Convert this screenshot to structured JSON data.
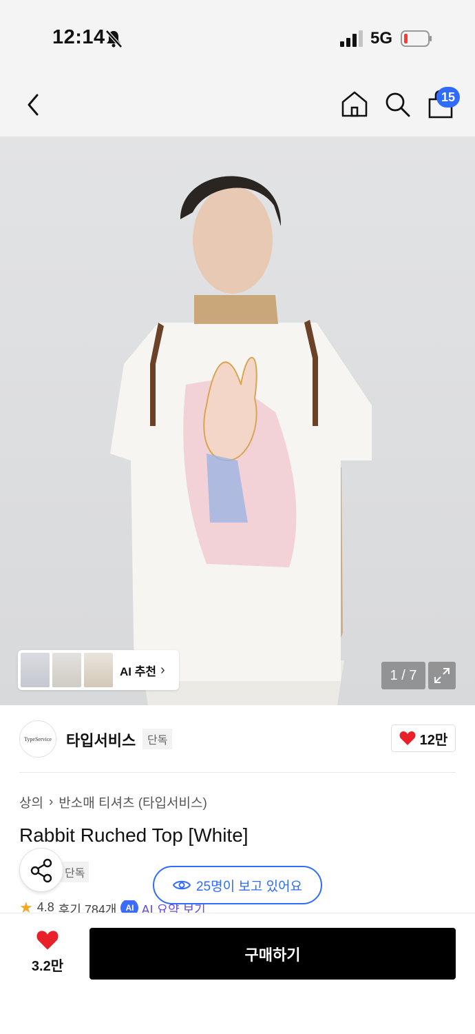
{
  "status": {
    "time": "12:14",
    "network": "5G"
  },
  "nav": {
    "cart_count": "15"
  },
  "gallery": {
    "counter": "1 / 7",
    "ai_label": "AI 추천"
  },
  "brand": {
    "logo_text": "TypeService",
    "name": "타입서비스",
    "tag": "단독",
    "likes": "12만"
  },
  "product": {
    "breadcrumb": [
      "상의",
      "반소매 티셔츠 (타입서비스)"
    ],
    "title": "Rabbit Ruched Top [White]",
    "exclusive_tag": "단독",
    "viewing": "25명이 보고 있어요",
    "rating": "4.8",
    "reviews": "후기 784개",
    "ai_summary": "AI 요약 보기"
  },
  "bottom": {
    "wish_count": "3.2만",
    "buy_label": "구매하기"
  },
  "colors": {
    "accent": "#2f6bff",
    "heart": "#e8202a",
    "buy": "#000000"
  }
}
